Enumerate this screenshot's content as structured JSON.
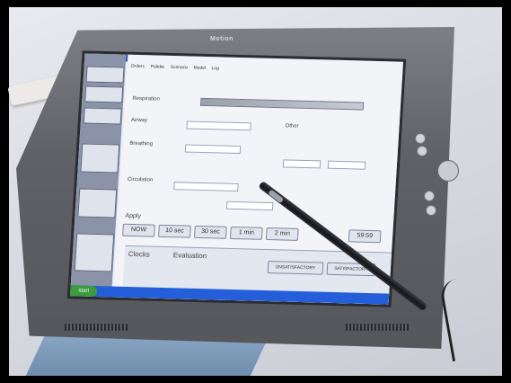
{
  "photo": {
    "device_brand": "Motion",
    "screen": {
      "tabs": [
        "Orders",
        "Palette",
        "Scenario",
        "Model",
        "Log"
      ],
      "sections": [
        "Respiration",
        "Airway",
        "Breathing",
        "Circulation",
        "Other"
      ],
      "apply_label": "Apply",
      "buttons": [
        "NOW",
        "10 sec",
        "30 sec",
        "1 min",
        "2 min"
      ],
      "clock_value": "59:59",
      "bottom_titles": [
        "Clocks",
        "Evaluation"
      ],
      "eval_buttons": [
        "UNSATISFACTORY",
        "SATISFACTORY"
      ],
      "taskbar_start": "start"
    }
  }
}
